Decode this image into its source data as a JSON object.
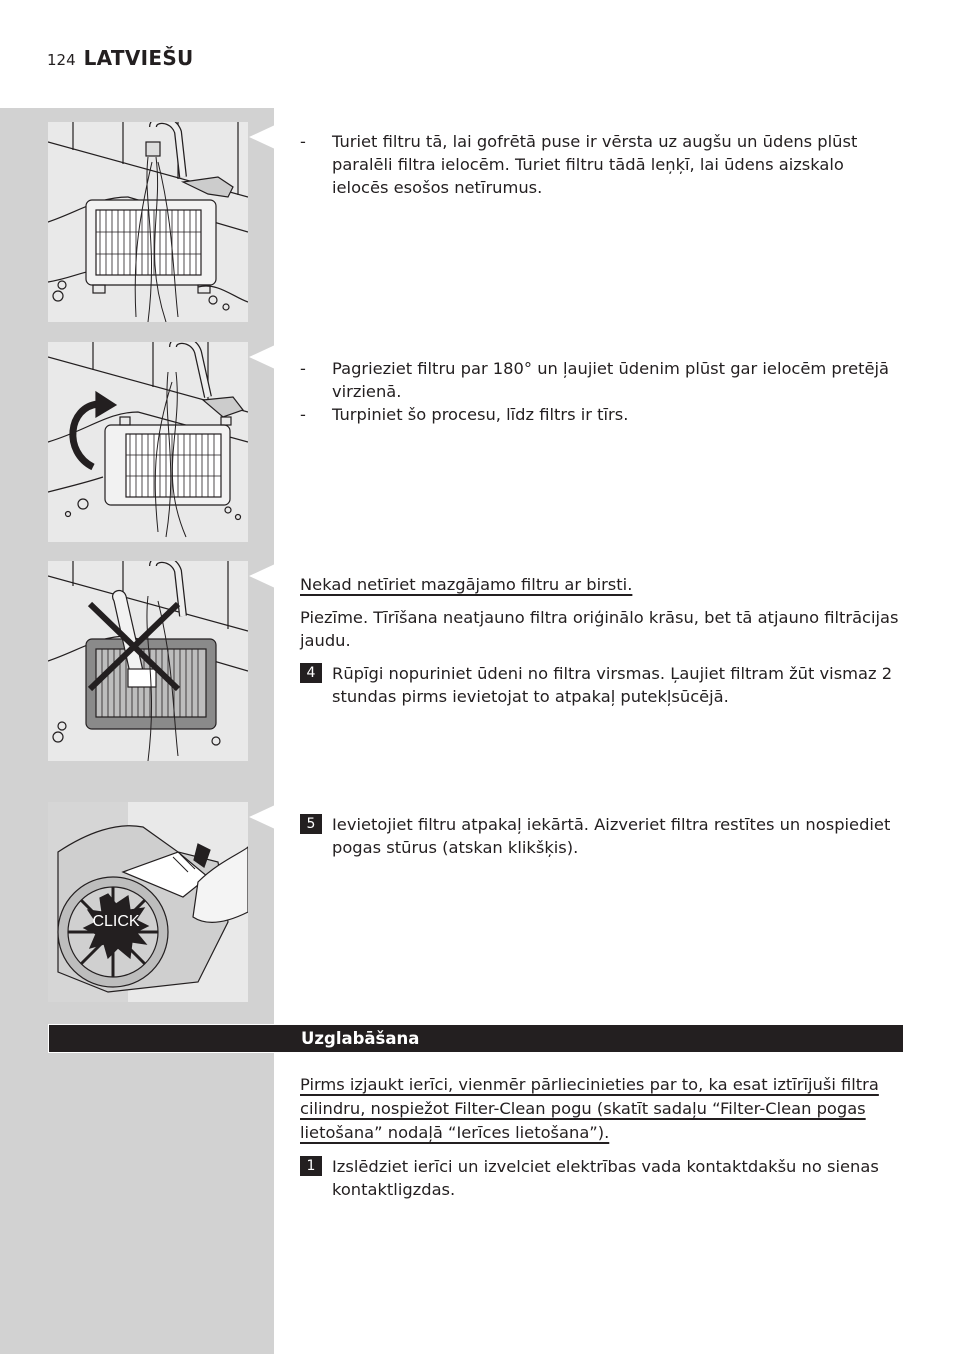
{
  "header": {
    "page_number": "124",
    "language": "LATVIEŠU"
  },
  "figures": [
    {
      "name": "filter-rinse-under-tap",
      "label": ""
    },
    {
      "name": "filter-rotate-180",
      "label": ""
    },
    {
      "name": "no-brush-cleaning",
      "label": ""
    },
    {
      "name": "insert-filter-click",
      "label": "CLICK"
    }
  ],
  "block1": {
    "bullets": [
      {
        "dash": "-",
        "text": "Turiet filtru tā, lai gofrētā puse ir vērsta uz augšu un ūdens plūst paralēli filtra ielocēm. Turiet filtru tādā leņķī, lai ūdens aizskalo ielocēs esošos netīrumus."
      }
    ]
  },
  "block2": {
    "bullets": [
      {
        "dash": "-",
        "text": "Pagrieziet filtru par 180° un ļaujiet ūdenim plūst gar ielocēm pretējā virzienā."
      },
      {
        "dash": "-",
        "text": "Turpiniet šo procesu, līdz filtrs ir tīrs."
      }
    ]
  },
  "block3": {
    "warning": "Nekad netīriet mazgājamo filtru ar birsti.",
    "note": "Piezīme. Tīrīšana neatjauno filtra oriģinālo krāsu, bet tā atjauno filtrācijas jaudu.",
    "step": {
      "number": "4",
      "text": "Rūpīgi nopuriniet ūdeni no filtra virsmas. Ļaujiet filtram žūt vismaz 2 stundas pirms ievietojat to atpakaļ putekļsūcējā."
    }
  },
  "block4": {
    "step": {
      "number": "5",
      "text": "Ievietojiet filtru atpakaļ iekārtā. Aizveriet filtra restītes un nospiediet pogas stūrus (atskan klikšķis)."
    }
  },
  "section": {
    "title": "Uzglabāšana",
    "warning": "Pirms izjaukt ierīci, vienmēr pārliecinieties par to, ka esat iztīrījuši filtra cilindru, nospiežot Filter-Clean pogu (skatīt sadaļu “Filter-Clean pogas lietošana” nodaļā “Ierīces lietošana”).",
    "step": {
      "number": "1",
      "text": "Izslēdziet ierīci un izvelciet elektrības vada kontaktdakšu no sienas kontaktligzdas."
    }
  }
}
